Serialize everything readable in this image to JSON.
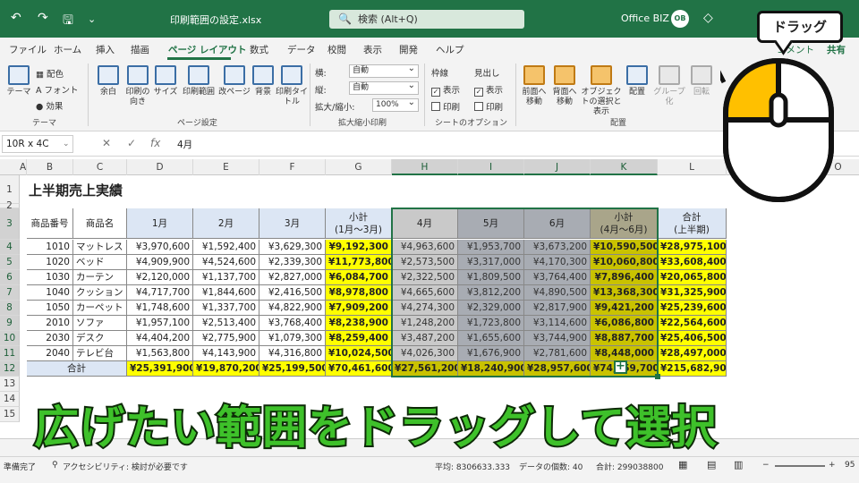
{
  "titlebar": {
    "doc_name": "印刷範囲の設定.xlsx",
    "search_placeholder": "検索 (Alt+Q)",
    "user_name": "Office BIZ",
    "avatar": "OB"
  },
  "menu": [
    "ファイル",
    "ホーム",
    "挿入",
    "描画",
    "ページ レイアウト",
    "数式",
    "データ",
    "校閲",
    "表示",
    "開発",
    "ヘルプ"
  ],
  "active_menu": "ページ レイアウト",
  "ribbon": {
    "theme_group": {
      "label": "テーマ",
      "theme": "テーマ",
      "colors": "配色",
      "fonts": "フォント",
      "effects": "効果"
    },
    "page_setup": {
      "label": "ページ設定",
      "margins": "余白",
      "orientation": "印刷の向き",
      "size": "サイズ",
      "print_area": "印刷範囲",
      "breaks": "改ページ",
      "background": "背景",
      "print_titles": "印刷タイトル"
    },
    "scale": {
      "label": "拡大縮小印刷",
      "width_label": "横:",
      "width_value": "自動",
      "height_label": "縦:",
      "height_value": "自動",
      "scale_label": "拡大/縮小:",
      "scale_value": "100%"
    },
    "sheet_options": {
      "label": "シートのオプション",
      "gridlines": "枠線",
      "headings": "見出し",
      "view": "表示",
      "print": "印刷"
    },
    "arrange": {
      "label": "配置",
      "bring_forward": "前面へ移動",
      "send_backward": "背面へ移動",
      "selection_pane": "オブジェクトの選択と表示",
      "align": "配置",
      "group": "グループ化",
      "rotate": "回転"
    },
    "comments": "コメント",
    "share": "共有"
  },
  "formula_bar": {
    "name_box": "10R x 4C",
    "cancel": "✕",
    "enter": "✓",
    "fx": "fx",
    "value": "4月"
  },
  "columns": [
    "A",
    "B",
    "C",
    "D",
    "E",
    "F",
    "G",
    "H",
    "I",
    "J",
    "K",
    "L",
    "M",
    "N",
    "O"
  ],
  "sheet_title": "上半期売上実績",
  "table": {
    "headers": [
      "商品番号",
      "商品名",
      "1月",
      "2月",
      "3月",
      "小計\n(1月〜3月)",
      "4月",
      "5月",
      "6月",
      "小計\n(4月〜6月)",
      "合計\n(上半期)"
    ],
    "rows": [
      [
        "1010",
        "マットレス",
        "¥3,970,600",
        "¥1,592,400",
        "¥3,629,300",
        "¥9,192,300",
        "¥4,963,600",
        "¥1,953,700",
        "¥3,673,200",
        "¥10,590,500",
        "¥28,975,100"
      ],
      [
        "1020",
        "ベッド",
        "¥4,909,900",
        "¥4,524,600",
        "¥2,339,300",
        "¥11,773,800",
        "¥2,573,500",
        "¥3,317,000",
        "¥4,170,300",
        "¥10,060,800",
        "¥33,608,400"
      ],
      [
        "1030",
        "カーテン",
        "¥2,120,000",
        "¥1,137,700",
        "¥2,827,000",
        "¥6,084,700",
        "¥2,322,500",
        "¥1,809,500",
        "¥3,764,400",
        "¥7,896,400",
        "¥20,065,800"
      ],
      [
        "1040",
        "クッション",
        "¥4,717,700",
        "¥1,844,600",
        "¥2,416,500",
        "¥8,978,800",
        "¥4,665,600",
        "¥3,812,200",
        "¥4,890,500",
        "¥13,368,300",
        "¥31,325,900"
      ],
      [
        "1050",
        "カーペット",
        "¥1,748,600",
        "¥1,337,700",
        "¥4,822,900",
        "¥7,909,200",
        "¥4,274,300",
        "¥2,329,000",
        "¥2,817,900",
        "¥9,421,200",
        "¥25,239,600"
      ],
      [
        "2010",
        "ソファ",
        "¥1,957,100",
        "¥2,513,400",
        "¥3,768,400",
        "¥8,238,900",
        "¥1,248,200",
        "¥1,723,800",
        "¥3,114,600",
        "¥6,086,800",
        "¥22,564,600"
      ],
      [
        "2030",
        "デスク",
        "¥4,404,200",
        "¥2,775,900",
        "¥1,079,300",
        "¥8,259,400",
        "¥3,487,200",
        "¥1,655,600",
        "¥3,744,900",
        "¥8,887,700",
        "¥25,406,500"
      ],
      [
        "2040",
        "テレビ台",
        "¥1,563,800",
        "¥4,143,900",
        "¥4,316,800",
        "¥10,024,500",
        "¥4,026,300",
        "¥1,676,900",
        "¥2,781,600",
        "¥8,448,000",
        "¥28,497,000"
      ]
    ],
    "total": [
      "合計",
      "¥25,391,900",
      "¥19,870,200",
      "¥25,199,500",
      "¥70,461,600",
      "¥27,561,200",
      "¥18,240,900",
      "¥28,957,600",
      "¥74,759,700",
      "¥215,682,900"
    ]
  },
  "status": {
    "ready": "準備完了",
    "accessibility": "アクセシビリティ: 検討が必要です",
    "average": "平均: 8306633.333",
    "count": "データの個数: 40",
    "sum": "合計: 299038800",
    "zoom": "95"
  },
  "overlay": {
    "caption": "広げたい範囲をドラッグして選択",
    "bubble": "ドラッグ"
  },
  "colors": {
    "accent": "#217346",
    "yellow": "#ffff00",
    "header_blue": "#dce6f4",
    "gray_sel": "#c9c9c9",
    "sel_dark": "#a8acb3"
  }
}
